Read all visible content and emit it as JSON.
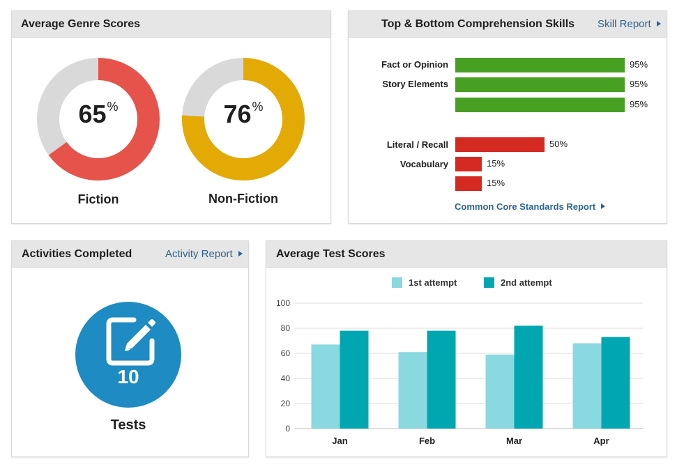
{
  "colors": {
    "fiction": "#e5534b",
    "nonfiction": "#e3aa06",
    "track": "#d9d9d9",
    "top_bar": "#48a022",
    "bottom_bar": "#d42a22",
    "link": "#2a6496",
    "tests_circle": "#1e8bc3",
    "attempt1": "#8ad8e0",
    "attempt2": "#00a7b0"
  },
  "genre": {
    "title": "Average Genre Scores",
    "items": [
      {
        "label": "Fiction",
        "value": 65,
        "display": "65",
        "unit": "%"
      },
      {
        "label": "Non-Fiction",
        "value": 76,
        "display": "76",
        "unit": "%"
      }
    ]
  },
  "skills": {
    "title": "Top & Bottom Comprehension Skills",
    "link": "Skill Report",
    "top": [
      {
        "label": "Fact or Opinion",
        "value": 95,
        "pct": "95%"
      },
      {
        "label": "Story Elements",
        "value": 95,
        "pct": "95%"
      },
      {
        "label": "",
        "value": 95,
        "pct": "95%"
      }
    ],
    "bottom": [
      {
        "label": "Literal / Recall",
        "value": 50,
        "pct": "50%"
      },
      {
        "label": "Vocabulary",
        "value": 15,
        "pct": "15%"
      },
      {
        "label": "",
        "value": 15,
        "pct": "15%"
      }
    ],
    "standards_link": "Common Core Standards Report"
  },
  "activities": {
    "title": "Activities Completed",
    "link": "Activity Report",
    "icon": "edit-icon",
    "count": "10",
    "label": "Tests"
  },
  "scores": {
    "title": "Average Test Scores"
  },
  "chart_data": {
    "type": "bar",
    "title": "Average Test Scores",
    "categories": [
      "Jan",
      "Feb",
      "Mar",
      "Apr"
    ],
    "series": [
      {
        "name": "1st attempt",
        "values": [
          67,
          61,
          59,
          68
        ]
      },
      {
        "name": "2nd attempt",
        "values": [
          78,
          78,
          82,
          73
        ]
      }
    ],
    "yticks": [
      "0",
      "20",
      "40",
      "60",
      "80",
      "100"
    ],
    "ylim": [
      0,
      100
    ],
    "grid": true,
    "legend": "top-center"
  }
}
